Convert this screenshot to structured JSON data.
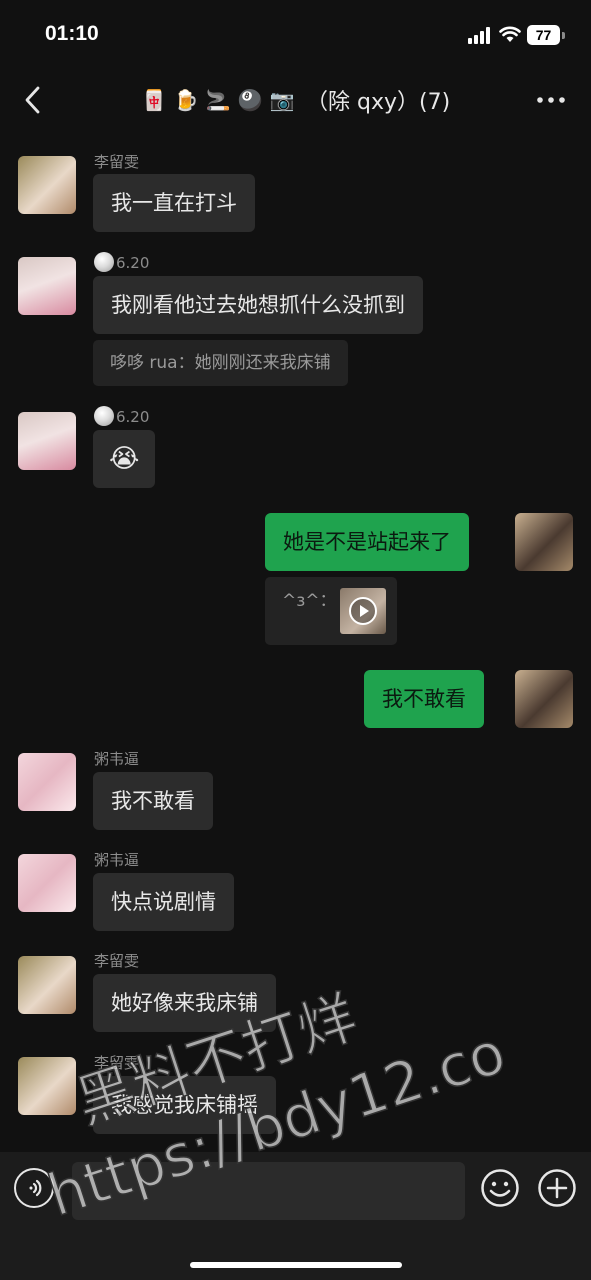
{
  "status_bar": {
    "time": "01:10",
    "battery": "77"
  },
  "nav": {
    "title_emojis": [
      "🀄",
      "🍺",
      "🚬",
      "🎱",
      "📷"
    ],
    "title": "（除 qxy）(7)"
  },
  "messages": [
    {
      "sender": "李留雯",
      "text": "我一直在打斗",
      "direction": "in"
    },
    {
      "sender": "6.20",
      "sender_badge": true,
      "text": "我刚看他过去她想抓什么没抓到",
      "direction": "in",
      "quote": "哆哆 rua：她刚刚还来我床铺"
    },
    {
      "sender": "6.20",
      "sender_badge": true,
      "text": "😭",
      "direction": "in"
    },
    {
      "sender": "",
      "text": "她是不是站起来了",
      "direction": "out",
      "quote": "^з^：",
      "quote_media": "video-thumbnail"
    },
    {
      "sender": "",
      "text": "我不敢看",
      "direction": "out"
    },
    {
      "sender": "粥韦逼",
      "text": "我不敢看",
      "direction": "in"
    },
    {
      "sender": "粥韦逼",
      "text": "快点说剧情",
      "direction": "in"
    },
    {
      "sender": "李留雯",
      "text": "她好像来我床铺",
      "direction": "in"
    },
    {
      "sender": "李留雯",
      "text": "我感觉我床铺摇",
      "direction": "in"
    }
  ],
  "input_bar": {
    "placeholder": ""
  },
  "watermark": {
    "line1": "黑料不打烊",
    "line2": "https://bdy12.co"
  },
  "colors": {
    "background": "#111111",
    "incoming_bubble": "#2c2c2c",
    "outgoing_bubble": "#1fa34e"
  },
  "icons": [
    "back-chevron-icon",
    "more-icon",
    "voice-icon",
    "emoji-icon",
    "plus-icon",
    "play-icon"
  ]
}
